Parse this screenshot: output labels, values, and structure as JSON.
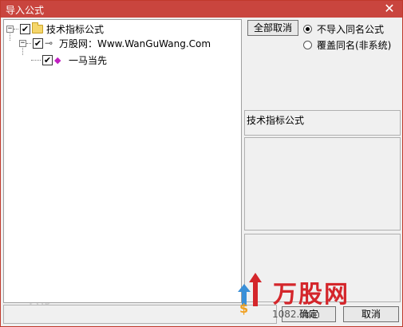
{
  "window": {
    "title": "导入公式",
    "close_glyph": "✕"
  },
  "tree": {
    "root": {
      "label": "技术指标公式",
      "checked": true
    },
    "child": {
      "label": "万股网：Www.WanGuWang.Com",
      "checked": true
    },
    "leaf": {
      "label": "一马当先",
      "checked": true
    }
  },
  "actions": {
    "cancel_all_label": "全部取消",
    "option_skip_label": "不导入同名公式",
    "option_overwrite_label": "覆盖同名(非系统)",
    "selected_option": "skip"
  },
  "info": {
    "category_label": "技术指标公式"
  },
  "footer": {
    "confirm_label": "确定",
    "cancel_label": "取消"
  },
  "branding": {
    "logo_text": "万股网",
    "url_text": "1082.com",
    "accent": "#d4262b"
  },
  "colors": {
    "titlebar": "#c9453e"
  }
}
